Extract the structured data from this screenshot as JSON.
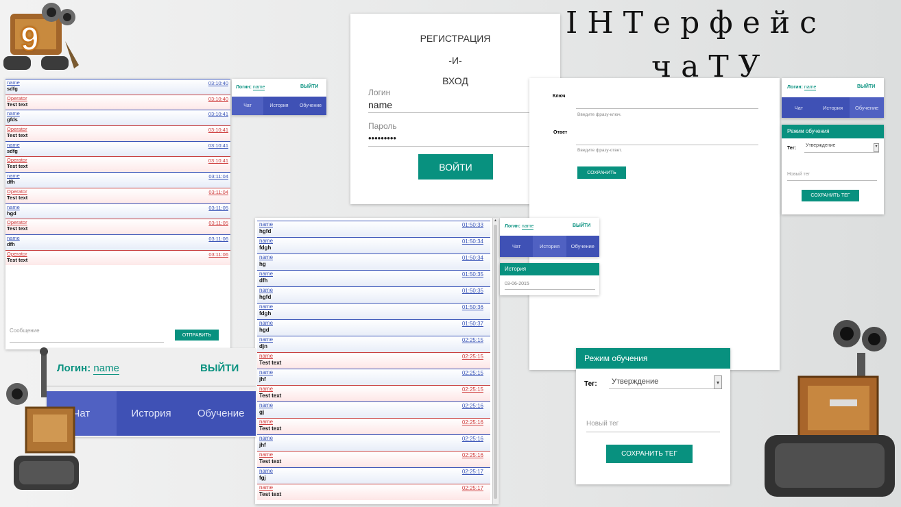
{
  "slide": {
    "number": "9",
    "title_line1": "ІНТерфейс",
    "title_line2": "чаТУ"
  },
  "colors": {
    "teal": "#08917f",
    "indigo": "#3f51b5",
    "user": "#3a55b8",
    "operator": "#d04040"
  },
  "chat_small": {
    "messages": [
      {
        "type": "user",
        "who": "name",
        "time": "03:10:40",
        "text": "sdfg"
      },
      {
        "type": "op",
        "who": "Operator",
        "time": "03:10:40",
        "text": "Test text"
      },
      {
        "type": "user",
        "who": "name",
        "time": "03:10:41",
        "text": "gfds"
      },
      {
        "type": "op",
        "who": "Operator",
        "time": "03:10:41",
        "text": "Test text"
      },
      {
        "type": "user",
        "who": "name",
        "time": "03:10:41",
        "text": "sdfg"
      },
      {
        "type": "op",
        "who": "Operator",
        "time": "03:10:41",
        "text": "Test text"
      },
      {
        "type": "user",
        "who": "name",
        "time": "03:11:04",
        "text": "dfh"
      },
      {
        "type": "op",
        "who": "Operator",
        "time": "03:11:04",
        "text": "Test text"
      },
      {
        "type": "user",
        "who": "name",
        "time": "03:11:05",
        "text": "hgd"
      },
      {
        "type": "op",
        "who": "Operator",
        "time": "03:11:05",
        "text": "Test text"
      },
      {
        "type": "user",
        "who": "name",
        "time": "03:11:06",
        "text": "dfh"
      },
      {
        "type": "op",
        "who": "Operator",
        "time": "03:11:06",
        "text": "Test text"
      }
    ],
    "input_placeholder": "Сообщение",
    "send_label": "ОТПРАВИТЬ"
  },
  "header_small": {
    "login_label": "Логин:",
    "login_value": "name",
    "logout": "ВЫЙТИ",
    "tabs": [
      "Чат",
      "История",
      "Обучение"
    ]
  },
  "register": {
    "title1": "РЕГИСТРАЦИЯ",
    "title2": "-И-",
    "title3": "ВХОД",
    "login_label": "Логин",
    "login_value": "name",
    "password_label": "Пароль",
    "password_value": "•••••••••",
    "submit": "ВОЙТИ"
  },
  "keyform": {
    "key_label": "Ключ",
    "key_placeholder": "Введите фразу-ключ.",
    "answer_label": "Ответ",
    "answer_placeholder": "Введите фразу-ответ.",
    "save": "СОХРАНИТЬ"
  },
  "header_right": {
    "login_label": "Логин:",
    "login_value": "name",
    "logout": "ВЫЙТИ",
    "tabs": [
      "Чат",
      "История",
      "Обучение"
    ]
  },
  "learn_small": {
    "title": "Режим обучения",
    "tag_label": "Тег:",
    "tag_value": "Утверждение",
    "newtag_placeholder": "Новый тег",
    "save": "СОХРАНИТЬ ТЕГ"
  },
  "chat_big": {
    "messages": [
      {
        "type": "user",
        "who": "name",
        "time": "01:50:33",
        "text": "hgfd"
      },
      {
        "type": "user",
        "who": "name",
        "time": "01:50:34",
        "text": "fdgh"
      },
      {
        "type": "user",
        "who": "name",
        "time": "01:50:34",
        "text": "hg"
      },
      {
        "type": "user",
        "who": "name",
        "time": "01:50:35",
        "text": "dfh"
      },
      {
        "type": "user",
        "who": "name",
        "time": "01:50:35",
        "text": "hgfd"
      },
      {
        "type": "user",
        "who": "name",
        "time": "01:50:36",
        "text": "fdgh"
      },
      {
        "type": "user",
        "who": "name",
        "time": "01:50:37",
        "text": "hgd"
      },
      {
        "type": "user",
        "who": "name",
        "time": "02:25:15",
        "text": "djn"
      },
      {
        "type": "op",
        "who": "name",
        "time": "02:25:15",
        "text": "Test text"
      },
      {
        "type": "user",
        "who": "name",
        "time": "02:25:15",
        "text": "jhf"
      },
      {
        "type": "op",
        "who": "name",
        "time": "02:25:15",
        "text": "Test text"
      },
      {
        "type": "user",
        "who": "name",
        "time": "02:25:16",
        "text": "gj"
      },
      {
        "type": "op",
        "who": "name",
        "time": "02:25:16",
        "text": "Test text"
      },
      {
        "type": "user",
        "who": "name",
        "time": "02:25:16",
        "text": "jhf"
      },
      {
        "type": "op",
        "who": "name",
        "time": "02:25:16",
        "text": "Test text"
      },
      {
        "type": "user",
        "who": "name",
        "time": "02:25:17",
        "text": "fgj"
      },
      {
        "type": "op",
        "who": "name",
        "time": "02:25:17",
        "text": "Test text"
      }
    ]
  },
  "header_mid": {
    "login_label": "Логин:",
    "login_value": "name",
    "logout": "ВЫЙТИ",
    "tabs": [
      "Чат",
      "История",
      "Обучение"
    ]
  },
  "history": {
    "title": "История",
    "date": "03-06-2015"
  },
  "header_big": {
    "login_label": "Логин:",
    "login_value": "name",
    "logout": "ВЫЙТИ",
    "tabs": [
      "Чат",
      "История",
      "Обучение"
    ]
  },
  "learn_big": {
    "title": "Режим обучения",
    "tag_label": "Тег:",
    "tag_value": "Утверждение",
    "newtag_placeholder": "Новый тег",
    "save": "СОХРАНИТЬ ТЕГ"
  }
}
